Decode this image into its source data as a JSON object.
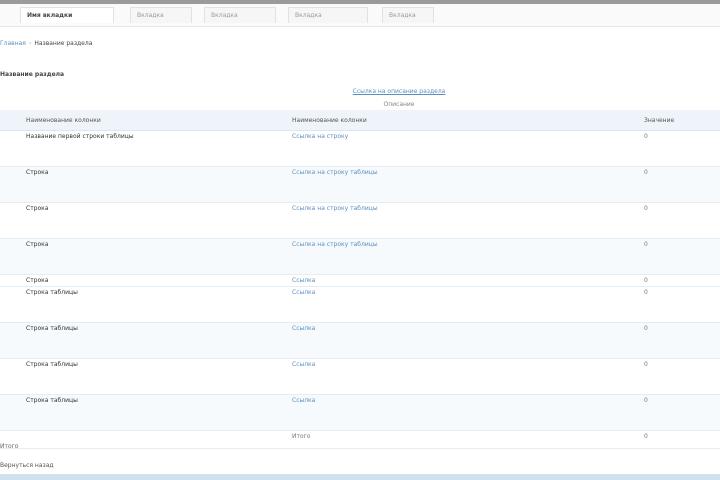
{
  "tabs": [
    "Имя вкладки",
    "Вкладка",
    "Вкладка",
    "Вкладка",
    "Вкладка"
  ],
  "breadcrumb": {
    "root": "Главная",
    "current": "Название раздела"
  },
  "section_title": "Название раздела",
  "center_link": "Ссылка на описание раздела",
  "center_note": "Описание",
  "table": {
    "headers": [
      "Наименование колонки",
      "Наименование колонки",
      "Значение"
    ],
    "rows": [
      {
        "name": "Название первой строки таблицы",
        "link": "Ссылка на строку",
        "value": "0"
      },
      {
        "name": "Строка",
        "link": "Ссылка на строку таблицы",
        "value": "0"
      },
      {
        "name": "Строка",
        "link": "Ссылка на строку таблицы",
        "value": "0"
      },
      {
        "name": "Строка",
        "link": "Ссылка на строку таблицы",
        "value": "0"
      },
      {
        "name": "Строка",
        "link": "Ссылка",
        "value": "0"
      },
      {
        "name": "Строка таблицы",
        "link": "Ссылка",
        "value": "0"
      },
      {
        "name": "Строка таблицы",
        "link": "Ссылка",
        "value": "0"
      },
      {
        "name": "Строка таблицы",
        "link": "Ссылка",
        "value": "0"
      },
      {
        "name": "Строка таблицы",
        "link": "Ссылка",
        "value": "0"
      },
      {
        "name": "",
        "link": "Итого",
        "value": "0"
      }
    ]
  },
  "footer": {
    "note": "Итого",
    "link": "Вернуться назад"
  }
}
